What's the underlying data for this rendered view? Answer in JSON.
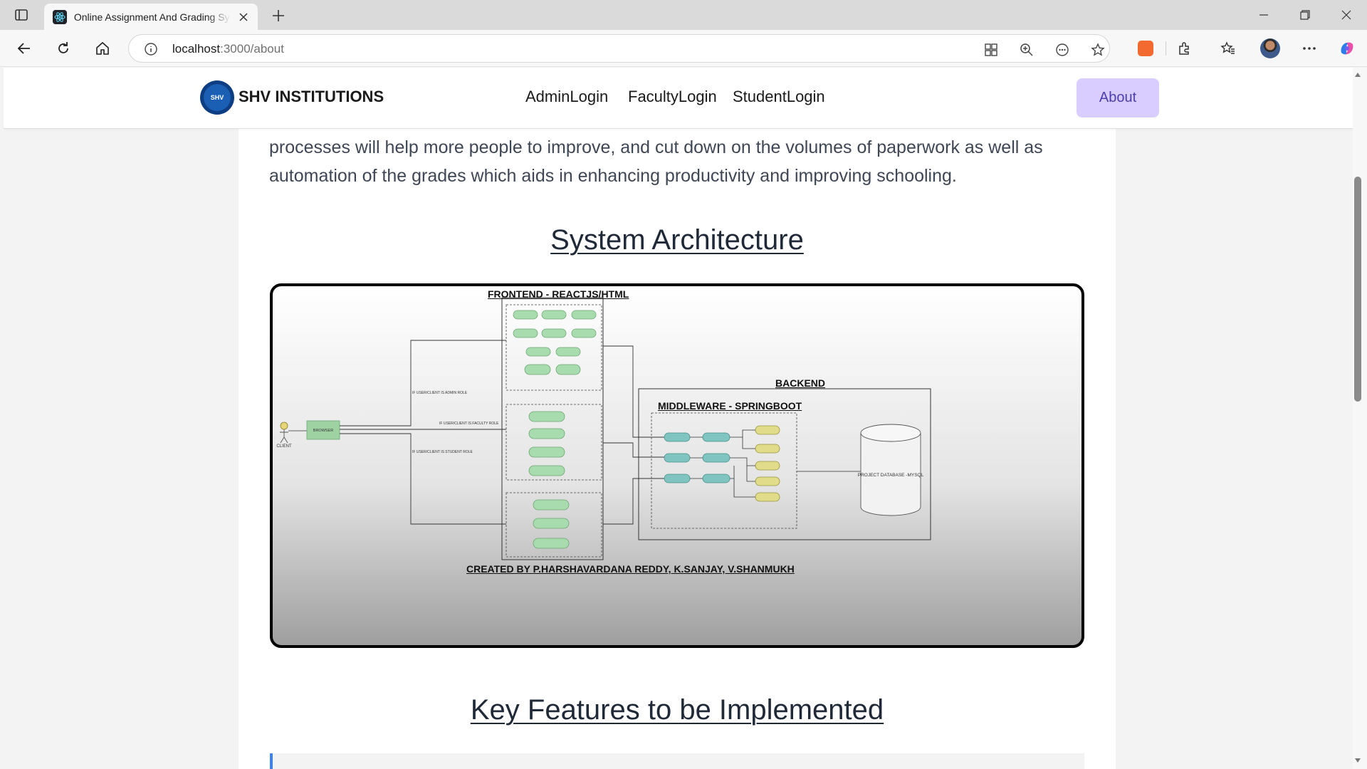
{
  "browser": {
    "tab_title": "Online Assignment And Grading System",
    "url_host": "localhost",
    "url_path": ":3000/about",
    "icons": [
      "tab-actions-icon",
      "react-favicon",
      "close-icon",
      "plus-icon",
      "minimize-icon",
      "restore-icon",
      "window-close-icon",
      "back-icon",
      "refresh-icon",
      "home-icon",
      "info-icon",
      "app-icon",
      "zoom-icon",
      "reading-icon",
      "star-icon",
      "extension-icon",
      "puzzle-icon",
      "favorites-icon",
      "more-icon",
      "copilot-icon"
    ]
  },
  "nav": {
    "brand": "SHV INSTITUTIONS",
    "logo_text": "SHV",
    "links": [
      "AdminLogin",
      "FacultyLogin",
      "StudentLogin"
    ],
    "about": "About",
    "about_color": "#d9ccff"
  },
  "content": {
    "intro_lines": [
      "processes will help more people to improve, and cut down on the volumes of paperwork as well as",
      "automation of the grades which aids in enhancing productivity and improving schooling."
    ],
    "heading_architecture": "System Architecture",
    "heading_features": "Key Features to be Implemented"
  },
  "diagram": {
    "frontend_title": "FRONTEND - REACTJS/HTML",
    "backend_title": "BACKEND",
    "middleware_title": "MIDDLEWARE - SPRINGBOOT",
    "created_by": "CREATED BY P.HARSHAVARDANA REDDY, K.SANJAY, V.SHANMUKH",
    "client_label": "CLIENT",
    "browser_label": "BROWSER",
    "edge_admin": "IF USER/CLIENT IS ADMIN ROLE",
    "edge_faculty": "IF USER/CLIENT IS FACULTY ROLE",
    "edge_student": "IF USER/CLIENT IS STUDENT ROLE",
    "database_label": "PROJECT DATABASE -MYSQL",
    "colors": {
      "frontend_node": "#a8dcae",
      "middleware_node": "#7fc4c0",
      "repo_node": "#e0dc8a"
    }
  }
}
